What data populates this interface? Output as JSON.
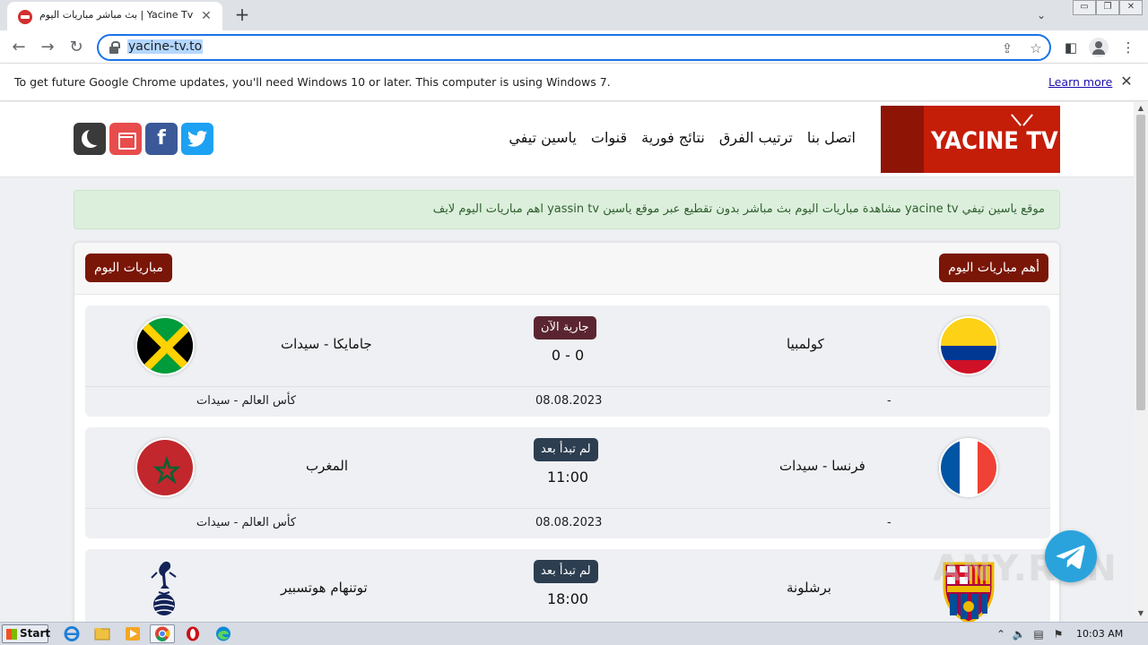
{
  "browser": {
    "tab_title": "Yacine Tv | بث مباشر مباريات اليوم",
    "url": "yacine-tv.to",
    "infobar_text": "To get future Google Chrome updates, you'll need Windows 10 or later. This computer is using Windows 7.",
    "learn_more": "Learn more"
  },
  "site": {
    "logo_text": "YACINE TV",
    "nav": [
      "ياسين تيفي",
      "قنوات",
      "نتائج فورية",
      "ترتيب الفرق",
      "اتصل بنا"
    ],
    "notice": "موقع ياسين تيفي yacine tv مشاهدة مباريات اليوم بث مباشر بدون تقطيع عبر موقع ياسين yassin tv اهم مباريات اليوم لايف",
    "panel_title_right": "أهم مباريات اليوم",
    "panel_title_left": "مباريات اليوم"
  },
  "matches": [
    {
      "home": "كولمبيا",
      "away": "جامايكا - سيدات",
      "status": "جارية الآن",
      "score": "0 - 0",
      "channel": "-",
      "date": "08.08.2023",
      "competition": "كأس العالم - سيدات"
    },
    {
      "home": "فرنسا - سيدات",
      "away": "المغرب",
      "status": "لم تبدأ بعد",
      "score": "11:00",
      "channel": "-",
      "date": "08.08.2023",
      "competition": "كأس العالم - سيدات"
    },
    {
      "home": "برشلونة",
      "away": "توتنهام هوتسبير",
      "status": "لم تبدأ بعد",
      "score": "18:00"
    }
  ],
  "watermark": "ANY.RUN",
  "taskbar": {
    "start": "Start",
    "clock": "10:03 AM"
  },
  "colors": {
    "brand_red": "#c41d08",
    "pill": "#7a1607",
    "live": "#5a2530",
    "pending": "#2c3e50",
    "omnibox_focus": "#1a73e8"
  }
}
